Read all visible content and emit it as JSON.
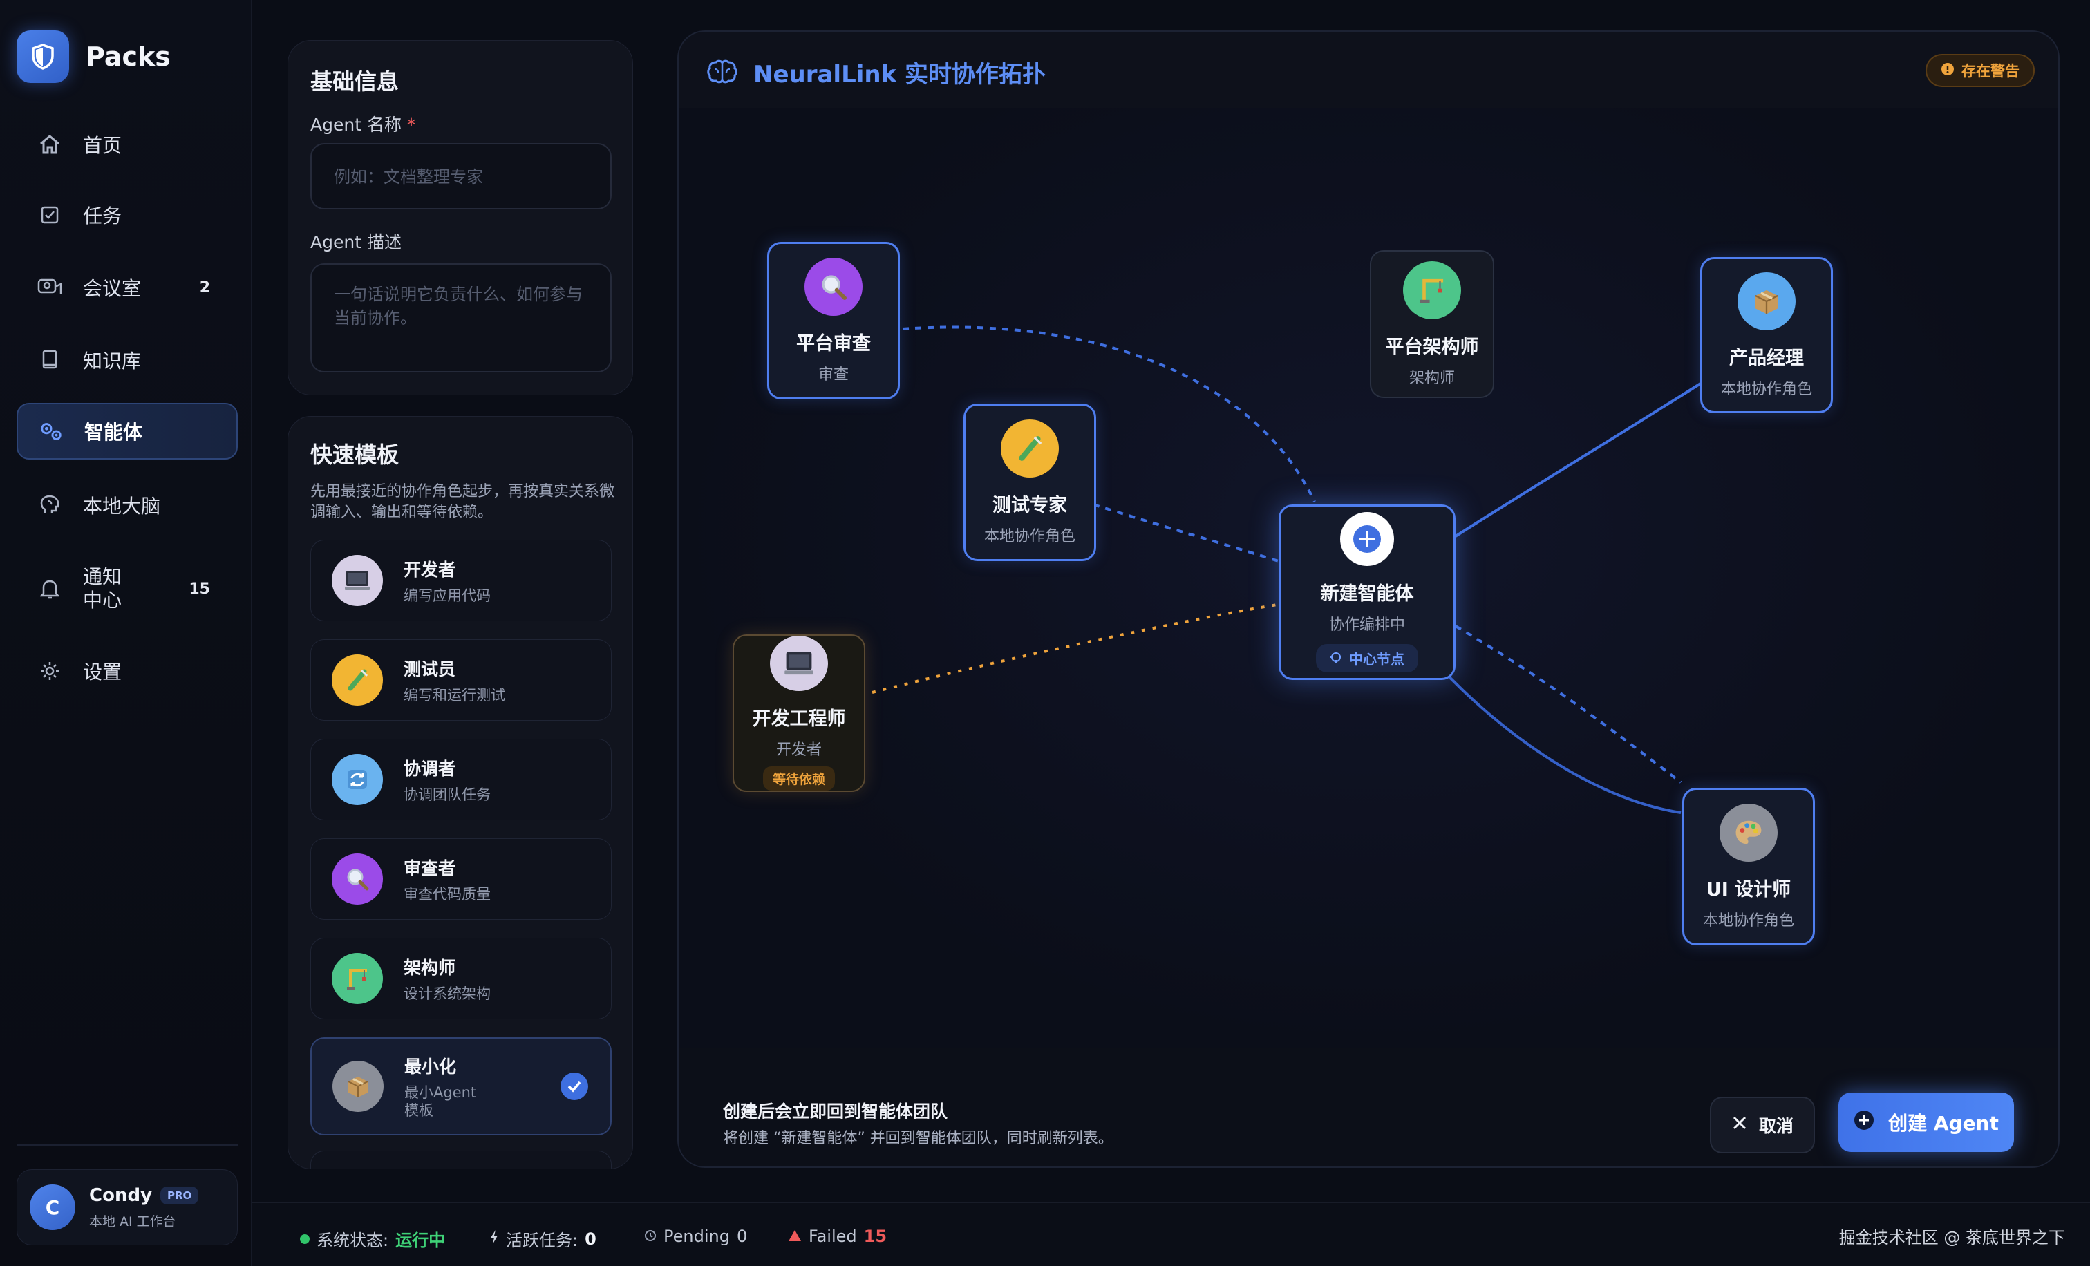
{
  "app": {
    "name": "Packs"
  },
  "nav": [
    {
      "label": "首页",
      "icon": "home-icon"
    },
    {
      "label": "任务",
      "icon": "checkbox-icon"
    },
    {
      "label": "会议室",
      "icon": "meeting-icon",
      "badge": "2"
    },
    {
      "label": "知识库",
      "icon": "book-icon"
    },
    {
      "label": "智能体",
      "icon": "agents-icon",
      "active": true
    },
    {
      "label": "本地大脑",
      "icon": "brain-icon"
    },
    {
      "label": "通知中心",
      "label_line1": "通知",
      "label_line2": "中心",
      "icon": "bell-icon",
      "badge": "15"
    },
    {
      "label": "设置",
      "icon": "gear-icon"
    }
  ],
  "user": {
    "initial": "C",
    "name": "Condy",
    "badge": "PRO",
    "subtitle": "本地 AI 工作台"
  },
  "basic": {
    "title": "基础信息",
    "name_label": "Agent 名称",
    "required_mark": "*",
    "name_placeholder": "例如：文档整理专家",
    "desc_label": "Agent 描述",
    "desc_placeholder": "一句话说明它负责什么、如何参与当前协作。"
  },
  "templates": {
    "title": "快速模板",
    "description": "先用最接近的协作角色起步，再按真实关系微调输入、输出和等待依赖。",
    "items": [
      {
        "title": "开发者",
        "subtitle": "编写应用代码",
        "icon": "computer-icon"
      },
      {
        "title": "测试员",
        "subtitle": "编写和运行测试",
        "icon": "test-tube-icon"
      },
      {
        "title": "协调者",
        "subtitle": "协调团队任务",
        "icon": "sync-icon"
      },
      {
        "title": "审查者",
        "subtitle": "审查代码质量",
        "icon": "magnifier-icon"
      },
      {
        "title": "架构师",
        "subtitle": "设计系统架构",
        "icon": "crane-icon"
      },
      {
        "title": "最小化",
        "subtitle_line1": "最小Agent",
        "subtitle_line2": "模板",
        "icon": "package-icon",
        "selected": true
      }
    ]
  },
  "topology": {
    "title": "NeuralLink 实时协作拓扑",
    "warning": "存在警告",
    "nodes": {
      "review": {
        "title": "平台审查",
        "subtitle": "审查"
      },
      "architect": {
        "title": "平台架构师",
        "subtitle": "架构师"
      },
      "pm": {
        "title": "产品经理",
        "subtitle": "本地协作角色"
      },
      "tester": {
        "title": "测试专家",
        "subtitle": "本地协作角色"
      },
      "center": {
        "title": "新建智能体",
        "subtitle": "协作编排中",
        "tag": "中心节点"
      },
      "dev": {
        "title": "开发工程师",
        "subtitle": "开发者",
        "tag": "等待依赖"
      },
      "ui": {
        "title": "UI 设计师",
        "subtitle": "本地协作角色"
      }
    },
    "footer": {
      "title": "创建后会立即回到智能体团队",
      "subtitle": "将创建 “新建智能体” 并回到智能体团队，同时刷新列表。",
      "cancel": "取消",
      "create": "创建 Agent"
    }
  },
  "status": {
    "system_label": "系统状态:",
    "system_value": "运行中",
    "active_label": "活跃任务:",
    "active_value": "0",
    "pending_label": "Pending",
    "pending_value": "0",
    "failed_label": "Failed",
    "failed_value": "15",
    "right_text": "掘金技术社区 @ 茶底世界之下"
  },
  "colors": {
    "accent": "#4f7ef0",
    "warning": "#f0a43c",
    "danger": "#ef5a5a",
    "success": "#31c46a",
    "background": "#0a0d16"
  }
}
